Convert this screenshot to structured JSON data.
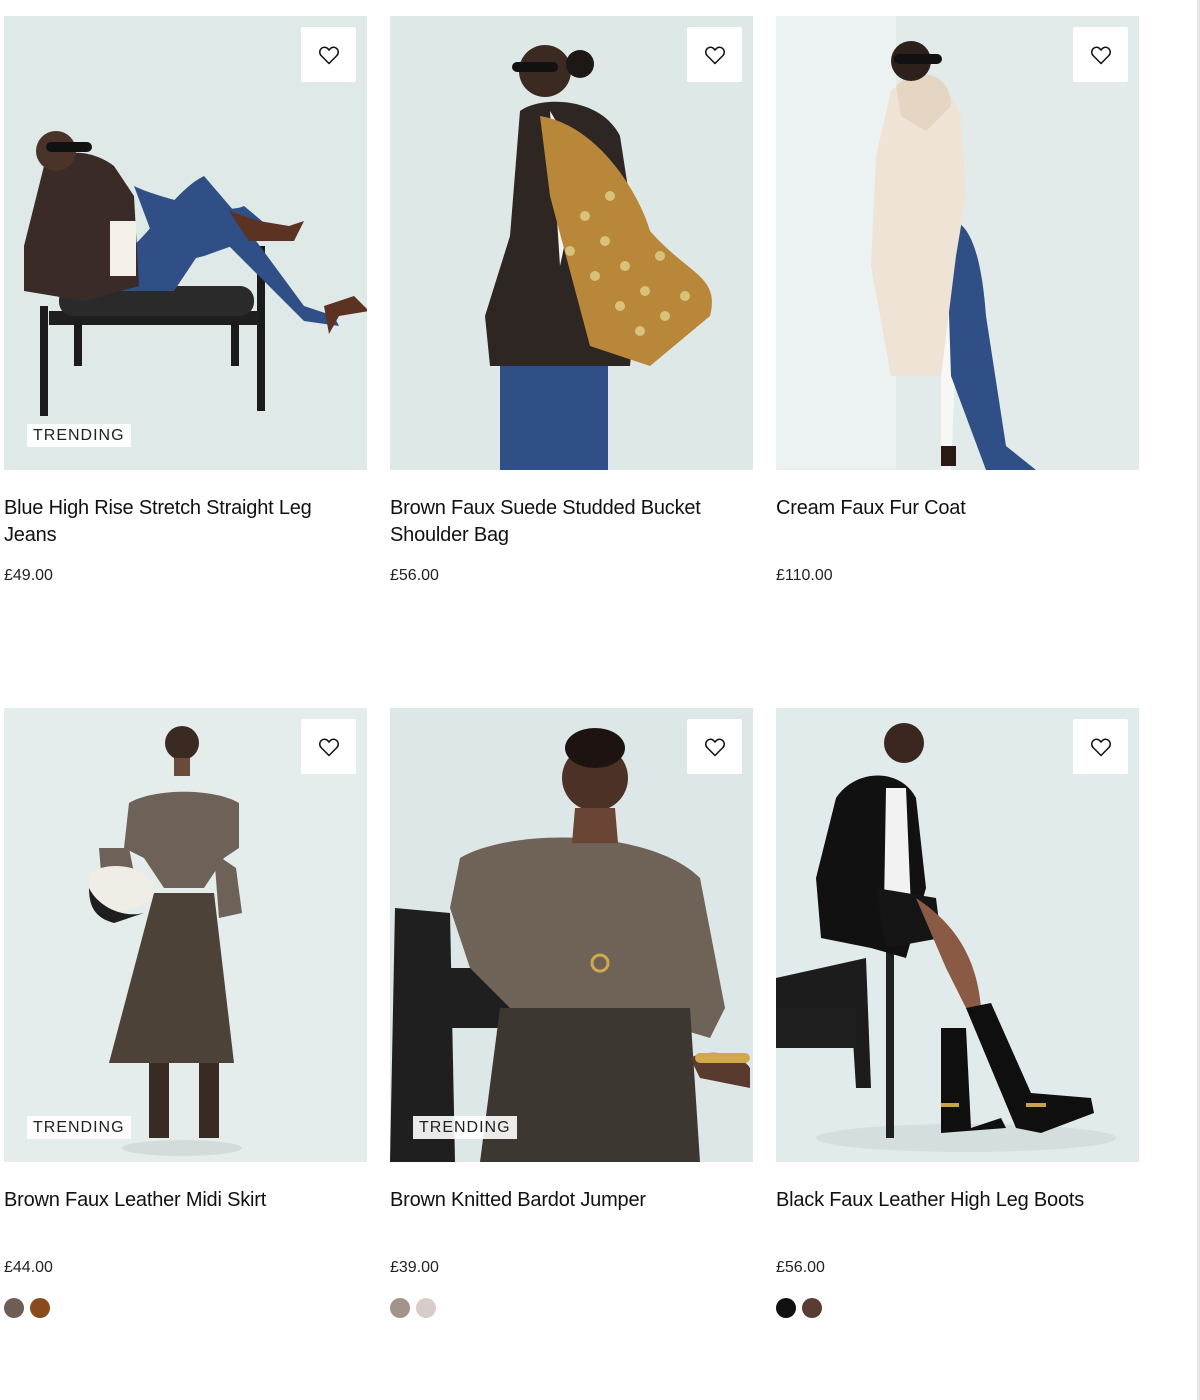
{
  "products": [
    {
      "name": "Blue High Rise Stretch Straight Leg Jeans",
      "price": "£49.00",
      "badge": "TRENDING",
      "wishlist_icon": "heart-icon",
      "image": "model seated in black chair wearing blue jeans and brown leather jacket",
      "colors": {
        "bg": "#dfe9e8",
        "a": "#2f4f86",
        "b": "#3a2b28"
      }
    },
    {
      "name": "Brown Faux Suede Studded Bucket Shoulder Bag",
      "price": "£56.00",
      "wishlist_icon": "heart-icon",
      "image": "model in profile with studded tan suede bucket bag",
      "colors": {
        "bg": "#dde8e7",
        "a": "#b8873a",
        "b": "#2e2622"
      }
    },
    {
      "name": "Cream Faux Fur Coat",
      "price": "£110.00",
      "wishlist_icon": "heart-icon",
      "image": "model in cream faux fur coat and flared blue jeans",
      "colors": {
        "bg": "#e3ebea",
        "a": "#eee3d4",
        "b": "#2f4f86"
      }
    },
    {
      "name": "Brown Faux Leather Midi Skirt",
      "price": "£44.00",
      "badge": "TRENDING",
      "wishlist_icon": "heart-icon",
      "image": "model in off shoulder knit and brown faux leather midi skirt",
      "colors": {
        "bg": "#e4ecec",
        "a": "#6e6258",
        "b": "#4c4238"
      },
      "swatches": [
        "#6e5d55",
        "#8a4b1c"
      ]
    },
    {
      "name": "Brown Knitted Bardot Jumper",
      "price": "£39.00",
      "badge": "TRENDING",
      "wishlist_icon": "heart-icon",
      "image": "model seated wearing brown knitted bardot jumper",
      "colors": {
        "bg": "#dde7e7",
        "a": "#6f6257",
        "b": "#1f1f1f"
      },
      "swatches": [
        "#a3948b",
        "#d6cdca"
      ]
    },
    {
      "name": "Black Faux Leather High Leg Boots",
      "price": "£56.00",
      "wishlist_icon": "heart-icon",
      "image": "model leaning on chair wearing black faux leather high leg boots",
      "colors": {
        "bg": "#e2ebeb",
        "a": "#111111",
        "b": "#f2f2f2"
      },
      "swatches": [
        "#111111",
        "#5a3c34"
      ]
    }
  ]
}
